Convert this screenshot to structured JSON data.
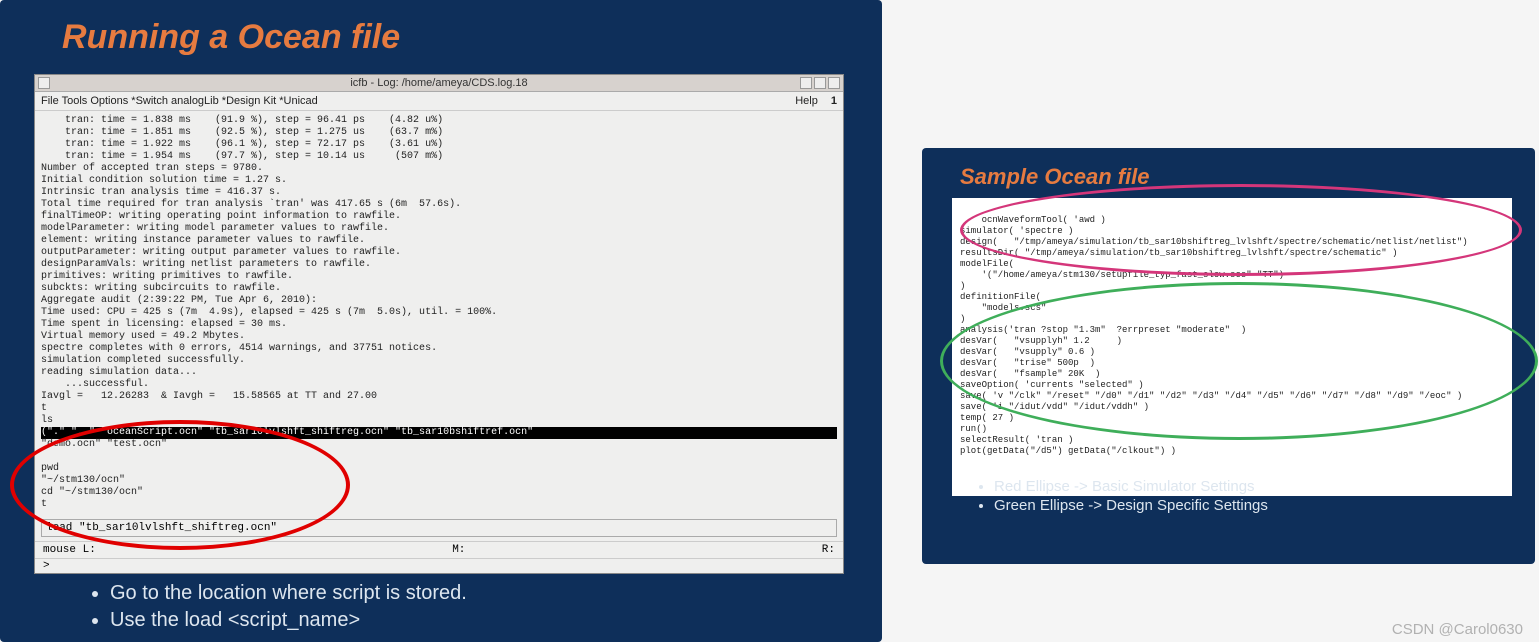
{
  "left": {
    "title": "Running a Ocean file",
    "window_title": "icfb - Log: /home/ameya/CDS.log.18",
    "menubar": "File  Tools  Options  *Switch analogLib  *Design Kit  *Unicad",
    "menubar_right_help": "Help",
    "menubar_right_num": "1",
    "term_top": "    tran: time = 1.838 ms    (91.9 %), step = 96.41 ps    (4.82 u%)\n    tran: time = 1.851 ms    (92.5 %), step = 1.275 us    (63.7 m%)\n    tran: time = 1.922 ms    (96.1 %), step = 72.17 ps    (3.61 u%)\n    tran: time = 1.954 ms    (97.7 %), step = 10.14 us     (507 m%)\nNumber of accepted tran steps = 9780.\nInitial condition solution time = 1.27 s.\nIntrinsic tran analysis time = 416.37 s.\nTotal time required for tran analysis `tran' was 417.65 s (6m  57.6s).\nfinalTimeOP: writing operating point information to rawfile.\nmodelParameter: writing model parameter values to rawfile.\nelement: writing instance parameter values to rawfile.\noutputParameter: writing output parameter values to rawfile.\ndesignParamVals: writing netlist parameters to rawfile.\nprimitives: writing primitives to rawfile.\nsubckts: writing subcircuits to rawfile.\nAggregate audit (2:39:22 PM, Tue Apr 6, 2010):\nTime used: CPU = 425 s (7m  4.9s), elapsed = 425 s (7m  5.0s), util. = 100%.\nTime spent in licensing: elapsed = 30 ms.\nVirtual memory used = 49.2 Mbytes.\nspectre completes with 0 errors, 4514 warnings, and 37751 notices.\nsimulation completed successfully.\nreading simulation data...\n    ...successful.\nIavgl =   12.26283  & Iavgh =   15.58565 at TT and 27.00\nt\nls",
    "term_hilite": "(\".\" \"..\" \"oceanScript.ocn\" \"tb_sar10lvlshft_shiftreg.ocn\" \"tb_sar10bshiftref.ocn\"",
    "term_after": "\"demo.ocn\" \"test.ocn\"\n\npwd\n\"~/stm130/ocn\"\ncd \"~/stm130/ocn\"\nt",
    "cmdline": "load \"tb_sar10lvlshft_shiftreg.ocn\"",
    "status_l": "mouse L:",
    "status_m": "M:",
    "status_r": "R:",
    "prompt": ">",
    "bullets": [
      "Go to the location where script is stored.",
      "Use the load <script_name>"
    ]
  },
  "right": {
    "title": "Sample Ocean file",
    "code": "ocnWaveformTool( 'awd )\nsimulator( 'spectre )\ndesign(   \"/tmp/ameya/simulation/tb_sar10bshiftreg_lvlshft/spectre/schematic/netlist/netlist\")\nresultsDir( \"/tmp/ameya/simulation/tb_sar10bshiftreg_lvlshft/spectre/schematic\" )\nmodelFile(\n    '(\"/home/ameya/stm130/setupfile_typ_fast_slow.scs\" \"TT\")\n)\ndefinitionFile(\n    \"models.scs\"\n)\nanalysis('tran ?stop \"1.3m\"  ?errpreset \"moderate\"  )\ndesVar(   \"vsupplyh\" 1.2     )\ndesVar(   \"vsupply\" 0.6 )\ndesVar(   \"trise\" 500p  )\ndesVar(   \"fsample\" 20K  )\nsaveOption( 'currents \"selected\" )\nsave( 'v \"/clk\" \"/reset\" \"/d0\" \"/d1\" \"/d2\" \"/d3\" \"/d4\" \"/d5\" \"/d6\" \"/d7\" \"/d8\" \"/d9\" \"/eoc\" )\nsave( 'i \"/idut/vdd\" \"/idut/vddh\" )\ntemp( 27 )\nrun()\nselectResult( 'tran )\nplot(getData(\"/d5\") getData(\"/clkout\") )",
    "bullets": [
      "Red Ellipse -> Basic Simulator Settings",
      "Green Ellipse -> Design Specific Settings"
    ]
  },
  "watermark": "CSDN @Carol0630"
}
